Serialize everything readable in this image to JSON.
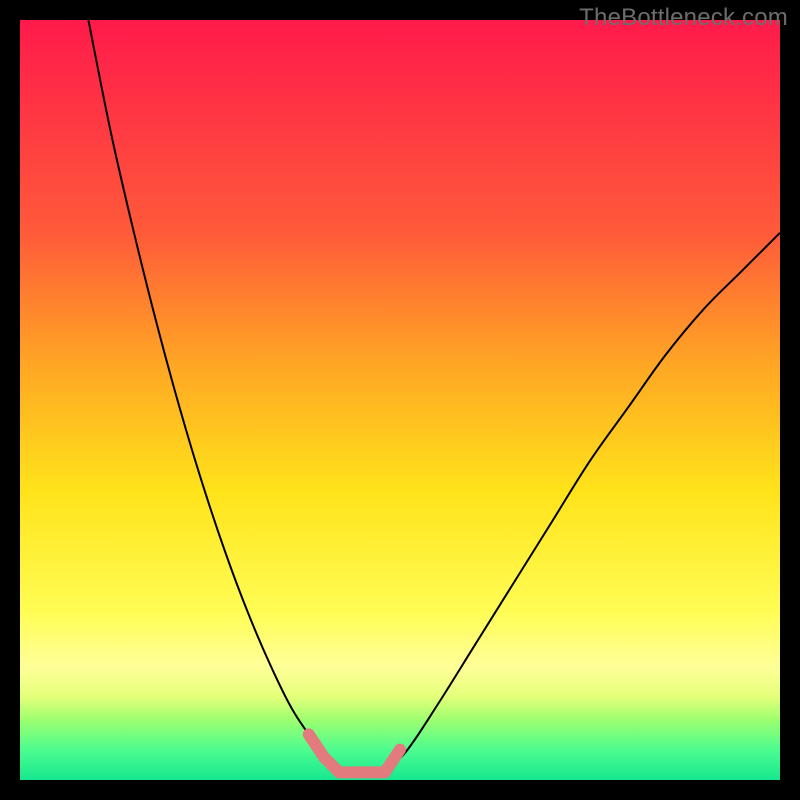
{
  "watermark": {
    "text": "TheBottleneck.com"
  },
  "chart_data": {
    "type": "line",
    "title": "",
    "xlabel": "",
    "ylabel": "",
    "xlim": [
      0,
      100
    ],
    "ylim": [
      0,
      100
    ],
    "grid": false,
    "legend": false,
    "series": [
      {
        "name": "left-curve",
        "x": [
          9,
          12,
          15,
          18,
          21,
          24,
          27,
          30,
          33,
          36,
          39.5,
          42
        ],
        "values": [
          100,
          85,
          72,
          60,
          49,
          39,
          30,
          22,
          15,
          9,
          4,
          1
        ]
      },
      {
        "name": "right-curve",
        "x": [
          48,
          51,
          55,
          60,
          65,
          70,
          75,
          80,
          85,
          90,
          95,
          100
        ],
        "values": [
          1,
          4,
          10,
          18,
          26,
          34,
          42,
          49,
          56,
          62,
          67,
          72
        ]
      },
      {
        "name": "optimal-range-marker",
        "x": [
          38,
          40,
          42,
          44,
          46,
          48,
          50
        ],
        "values": [
          6,
          3,
          1,
          1,
          1,
          1,
          4
        ]
      }
    ]
  }
}
